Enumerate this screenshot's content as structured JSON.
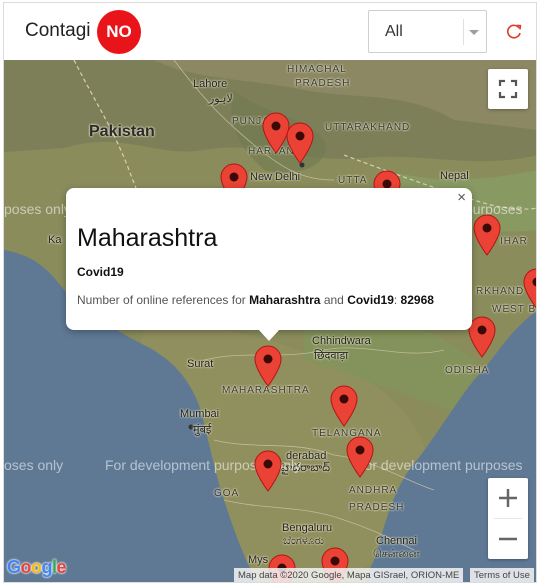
{
  "header": {
    "brand": "Contagi",
    "badge": "NO",
    "filter_value": "All",
    "refresh_icon": "refresh-icon",
    "badge_color": "#e8141a"
  },
  "map": {
    "labels": {
      "pakistan": "Pakistan",
      "nepal": "Nepal",
      "lahore": "Lahore",
      "lahore_local": "لاہور",
      "himachal": "HIMACHAL",
      "himachal2": "PRADESH",
      "punjab": "PUNJAB",
      "haryana": "HARYAN",
      "new_delhi": "New Delhi",
      "uttarakhand": "UTTARAKHAND",
      "uttar": "UTTA",
      "bihar": "IHAR",
      "jharkhand": "RKHAND",
      "west_bengal": "WEST B",
      "chhindwara": "Chhindwara",
      "chhindwara_local": "छिंदवाड़ा",
      "odisha": "ODISHA",
      "surat": "Surat",
      "maharashtra": "MAHARASHTRA",
      "mumbai": "Mumbai",
      "mumbai_local": "मुंबई",
      "telangana": "TELANGANA",
      "hyderabad": "derabad",
      "hyderabad_local": "హైదరాబాద్",
      "goa": "GOA",
      "andhra": "ANDHRA",
      "pradesh": "PRADESH",
      "bengaluru": "Bengaluru",
      "bengaluru_local": "ಬೆಂಗಳೂರು",
      "chennai": "Chennai",
      "chennai_local": "சென்னை",
      "mysuru": "Mys",
      "kutch": "Ka"
    },
    "watermark_left": "poses only",
    "watermark_mid": "For development purposes only",
    "watermark_right": "For development purposes",
    "watermark_left2": "oses only",
    "watermark_mid2": "For development purposes only",
    "watermark_right2": "For development purposes",
    "attribution": "Map data ©2020 Google, Mapa GISrael, ORION-ME",
    "terms": "Terms of Use",
    "google_logo": "Google",
    "fullscreen_icon": "fullscreen-icon",
    "zoom_in": "+",
    "zoom_out": "−",
    "pin_color": "#ea4335"
  },
  "info_window": {
    "title": "Maharashtra",
    "subject": "Covid19",
    "detail_prefix": "Number of online references for",
    "detail_region": "Maharashtra",
    "detail_and": "and",
    "detail_subject": "Covid19",
    "detail_count": "82968",
    "close": "×"
  }
}
